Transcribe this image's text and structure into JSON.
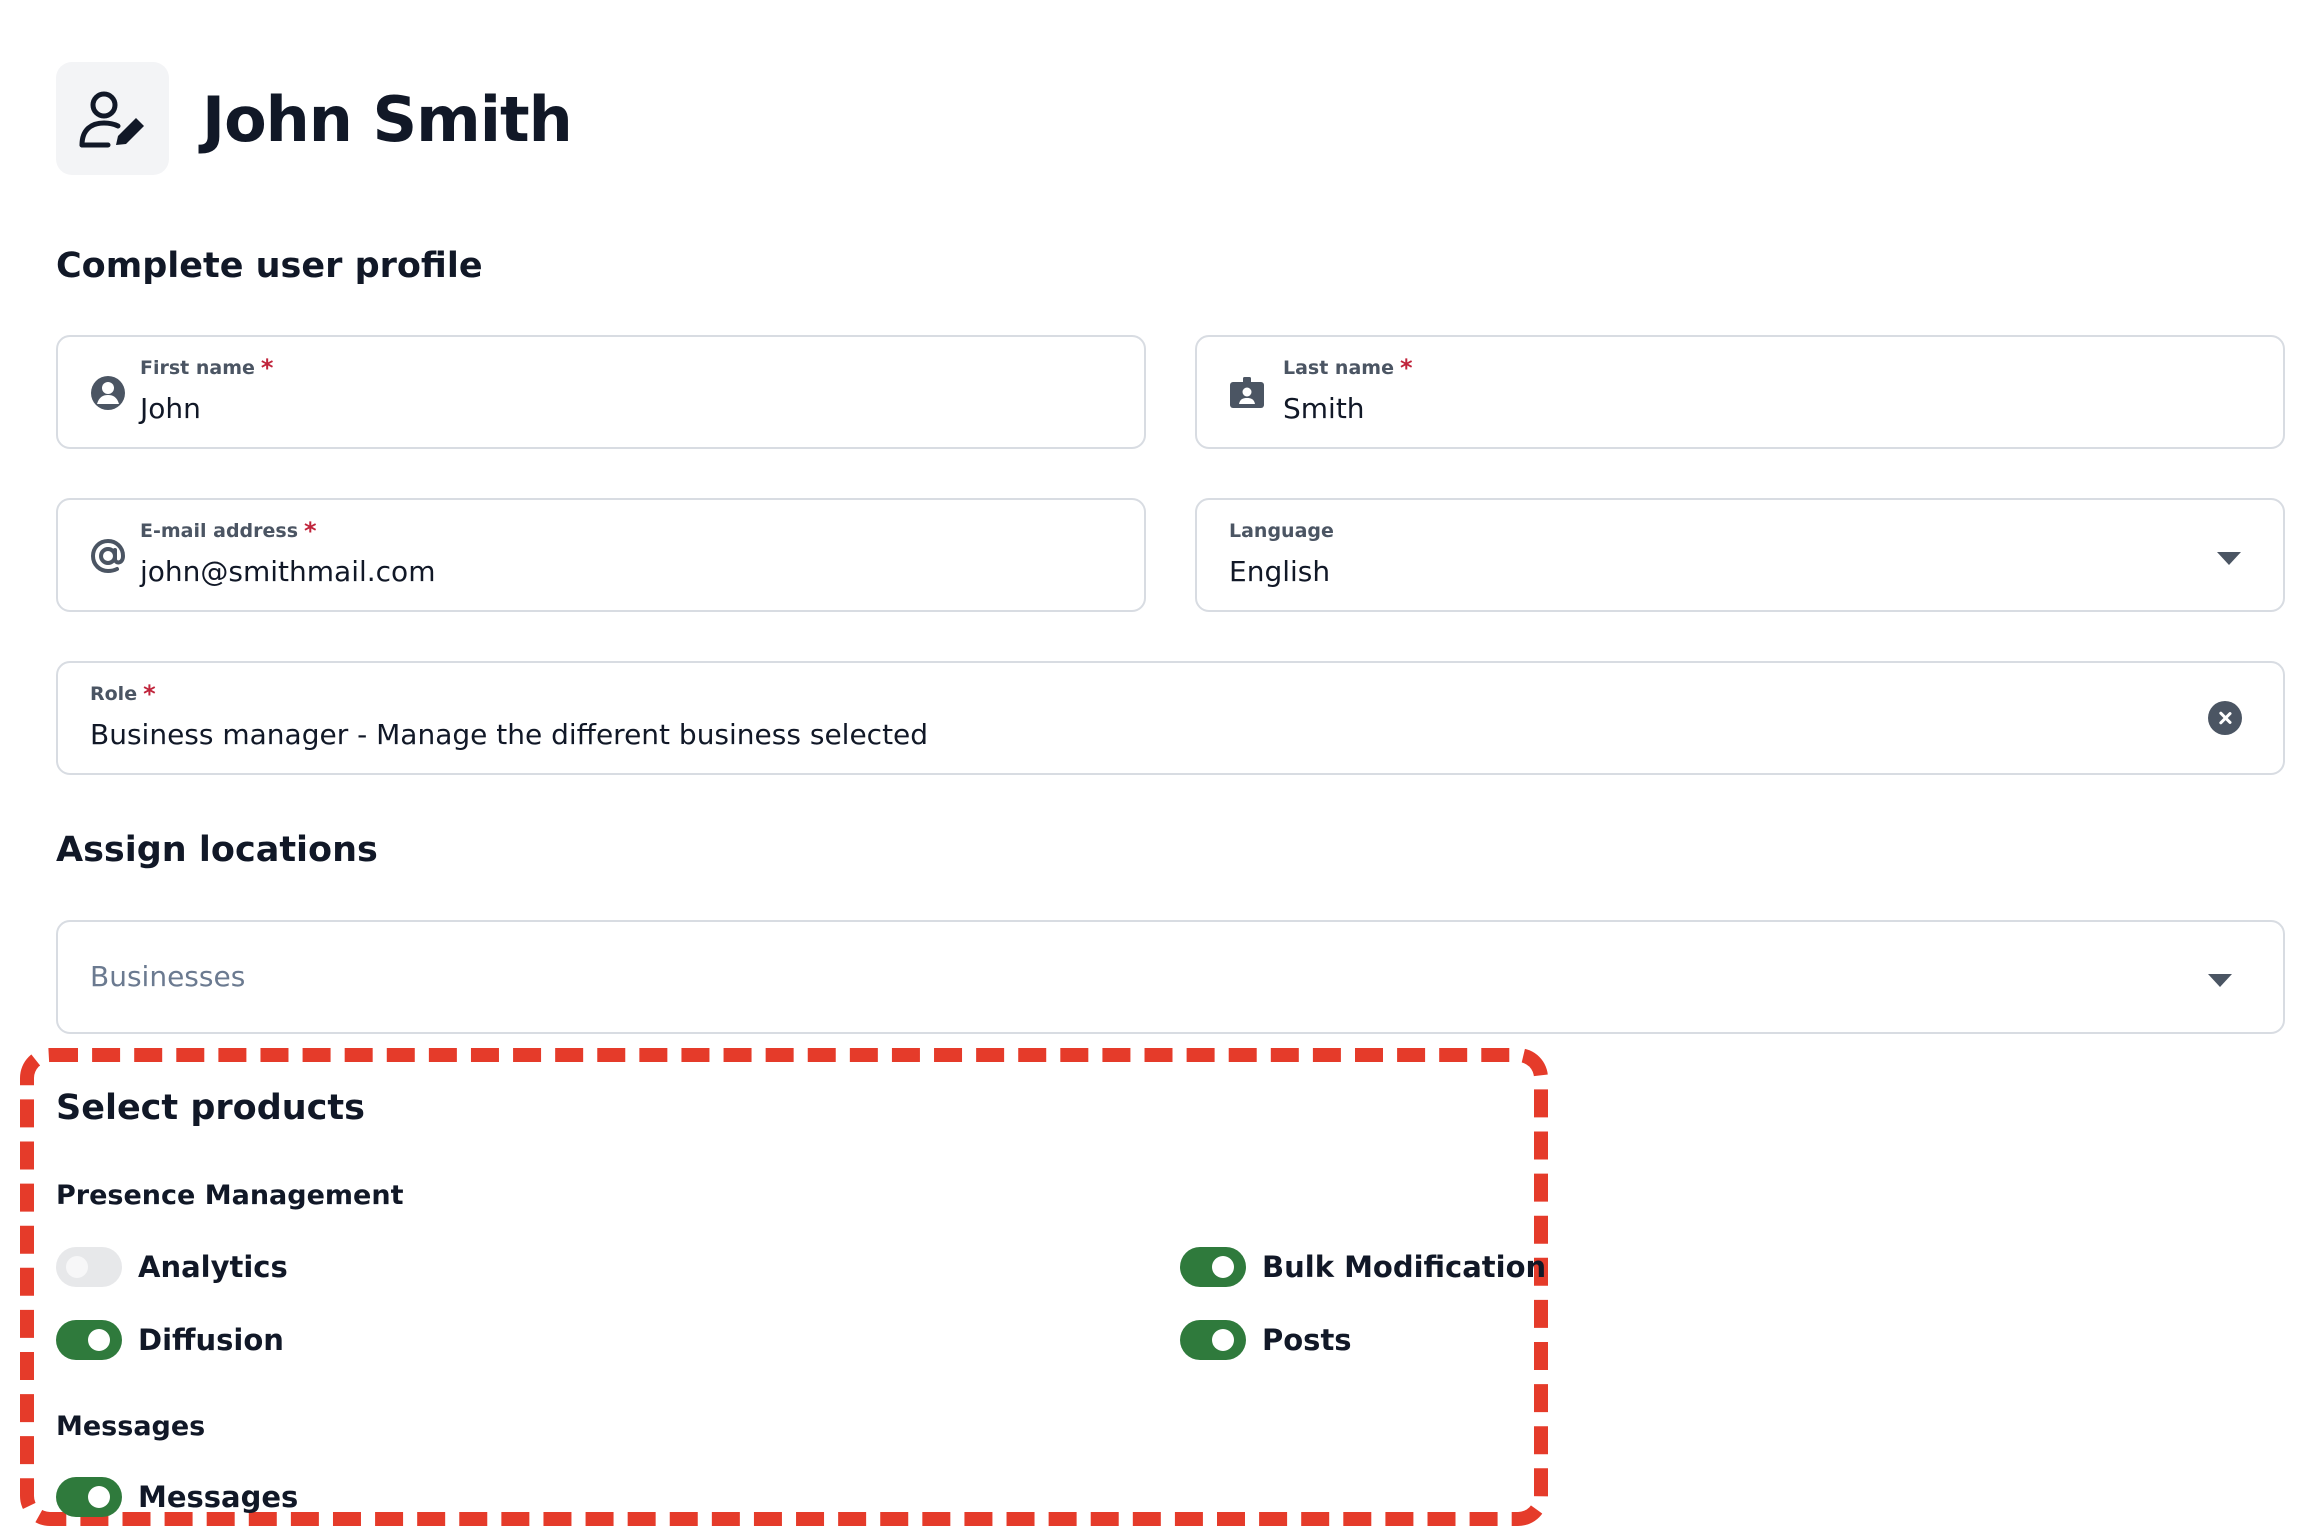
{
  "header": {
    "title": "John Smith",
    "avatar_icon": "user-edit-icon"
  },
  "profile": {
    "section_title": "Complete user profile",
    "first_name": {
      "label": "First name",
      "value": "John",
      "required": "*"
    },
    "last_name": {
      "label": "Last name",
      "value": "Smith",
      "required": "*"
    },
    "email": {
      "label": "E-mail address",
      "value": "john@smithmail.com",
      "required": "*"
    },
    "language": {
      "label": "Language",
      "value": "English"
    },
    "role": {
      "label": "Role",
      "value": "Business manager - Manage the different business selected",
      "required": "*"
    }
  },
  "locations": {
    "section_title": "Assign locations",
    "businesses_placeholder": "Businesses"
  },
  "products": {
    "section_title": "Select products",
    "groups": [
      {
        "title": "Presence Management",
        "items": [
          {
            "label": "Analytics",
            "enabled": false
          },
          {
            "label": "Bulk Modification",
            "enabled": true
          },
          {
            "label": "Diffusion",
            "enabled": true
          },
          {
            "label": "Posts",
            "enabled": true
          }
        ]
      },
      {
        "title": "Messages",
        "items": [
          {
            "label": "Messages",
            "enabled": true
          }
        ]
      }
    ]
  },
  "colors": {
    "toggle_on": "#2f7a3c",
    "toggle_off": "#e7e8ea",
    "required": "#c0243b",
    "highlight": "#e53b2a"
  }
}
